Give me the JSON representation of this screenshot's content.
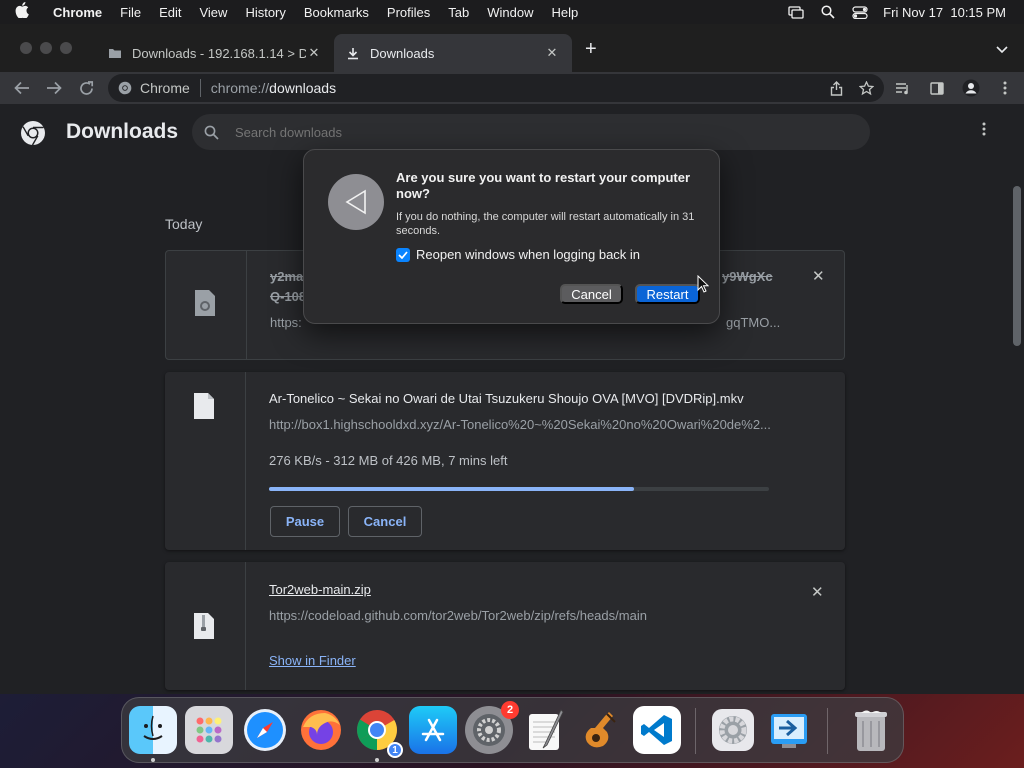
{
  "menubar": {
    "app_name": "Chrome",
    "menus": [
      "File",
      "Edit",
      "View",
      "History",
      "Bookmarks",
      "Profiles",
      "Tab",
      "Window",
      "Help"
    ],
    "clock": "Fri Nov 17  10:15 PM"
  },
  "tabs": [
    {
      "title": "Downloads - 192.168.1.14 > Do",
      "active": false
    },
    {
      "title": "Downloads",
      "active": true
    }
  ],
  "omnibox": {
    "chip_label": "Chrome",
    "url_scheme": "chrome://",
    "url_host": "downloads"
  },
  "downloads_page": {
    "title": "Downloads",
    "search_placeholder": "Search downloads",
    "section_label": "Today",
    "items": [
      {
        "name_start": "y2ma",
        "name_end": "y9WgXc",
        "name_line2": "Q-108",
        "url_start": "https:",
        "url_end": "gqTMO...",
        "deleted": true
      },
      {
        "name": "Ar-Tonelico ~ Sekai no Owari de Utai Tsuzukeru Shoujo OVA [MVO] [DVDRip].mkv",
        "url": "http://box1.highschooldxd.xyz/Ar-Tonelico%20~%20Sekai%20no%20Owari%20de%2...",
        "status": "276 KB/s - 312 MB of 426 MB, 7 mins left",
        "progress": 0.73,
        "pause_label": "Pause",
        "cancel_label": "Cancel"
      },
      {
        "name": "Tor2web-main.zip",
        "url": "https://codeload.github.com/tor2web/Tor2web/zip/refs/heads/main",
        "action_label": "Show in Finder"
      }
    ]
  },
  "dialog": {
    "title": "Are you sure you want to restart your computer now?",
    "message": "If you do nothing, the computer will restart automatically in 31 seconds.",
    "checkbox_label": "Reopen windows when logging back in",
    "checkbox_checked": true,
    "cancel_label": "Cancel",
    "restart_label": "Restart"
  },
  "dock": {
    "apps": [
      "finder",
      "launchpad",
      "safari",
      "firefox",
      "chrome",
      "app-store",
      "system-preferences",
      "textedit",
      "garageband",
      "vscode",
      "system-preferences-2",
      "migration-assistant",
      "trash"
    ],
    "chrome_badge": "1",
    "system_preferences_badge": "2"
  },
  "colors": {
    "accent": "#8ab4f8",
    "dialog_button": "#0a64d6",
    "badge": "#ff3b30"
  }
}
